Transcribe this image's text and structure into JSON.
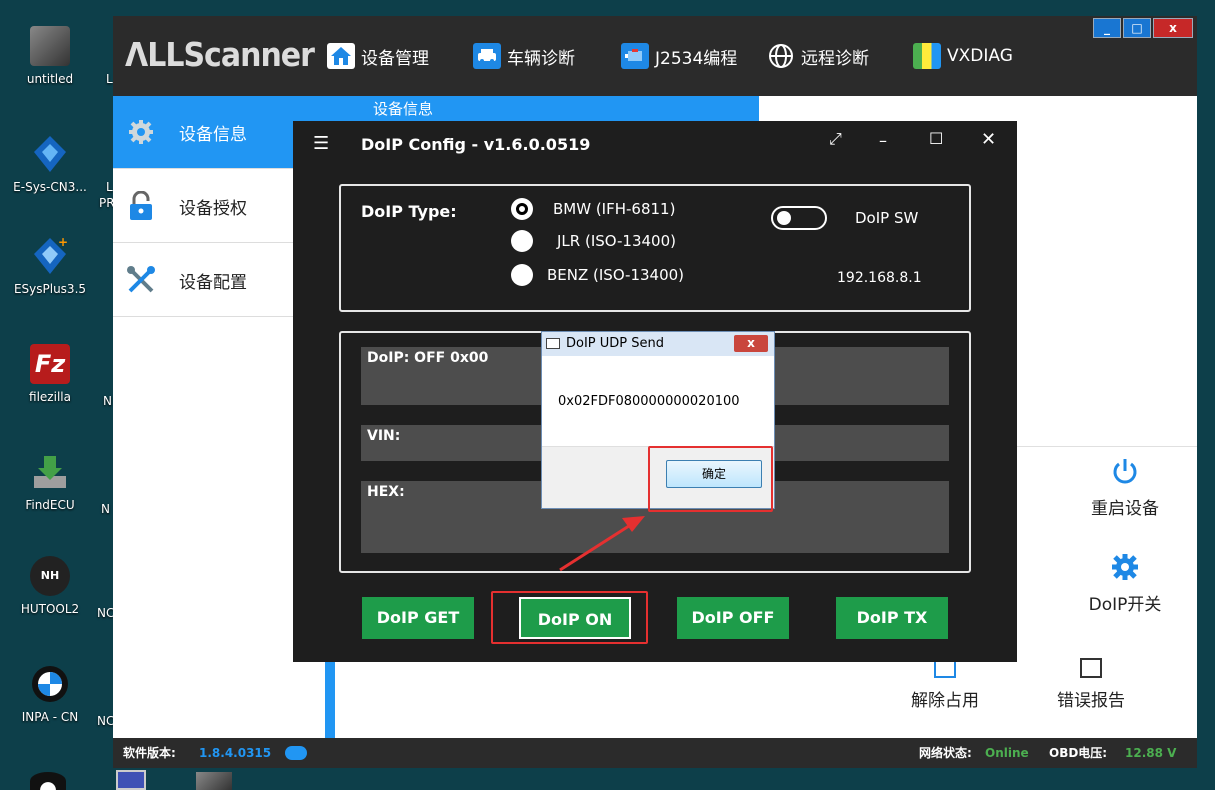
{
  "desktop": {
    "icons": [
      {
        "name": "untitled",
        "label": "untitled"
      },
      {
        "name": "esys",
        "label": "E-Sys-CN3..."
      },
      {
        "name": "esysplus",
        "label": "ESysPlus3.5"
      },
      {
        "name": "filezilla",
        "label": "filezilla"
      },
      {
        "name": "findecu",
        "label": "FindECU"
      },
      {
        "name": "hutool",
        "label": "HUTOOL2"
      },
      {
        "name": "inpa",
        "label": "INPA - CN"
      }
    ],
    "clipped_labels": [
      "L",
      "L",
      "PR",
      "N",
      "N",
      "NC",
      "NC"
    ],
    "clipped_left_labels": [
      ".",
      ".."
    ]
  },
  "app": {
    "logo": "ΛLLScanner",
    "nav": [
      {
        "label": "设备管理",
        "icon": "home-icon"
      },
      {
        "label": "车辆诊断",
        "icon": "car-icon"
      },
      {
        "label": "J2534编程",
        "icon": "engine-icon"
      },
      {
        "label": "远程诊断",
        "icon": "globe-icon"
      },
      {
        "label": "VXDIAG",
        "icon": "vxdiag-icon"
      }
    ],
    "window_buttons": {
      "minimize": "_",
      "maximize": "□",
      "close": "x"
    },
    "sidebar": [
      {
        "label": "设备信息",
        "icon": "gear-icon",
        "active": true
      },
      {
        "label": "设备授权",
        "icon": "lock-icon",
        "active": false
      },
      {
        "label": "设备配置",
        "icon": "tools-icon",
        "active": false
      }
    ],
    "content_header": "设备信息",
    "actions": {
      "restart": "重启设备",
      "doip_switch": "DoIP开关",
      "release": "解除占用",
      "error_report": "错误报告"
    },
    "status": {
      "version_label": "软件版本:",
      "version": "1.8.4.0315",
      "network_label": "网络状态:",
      "network": "Online",
      "obd_label": "OBD电压:",
      "obd": "12.88 V"
    }
  },
  "doip_config": {
    "title": "DoIP Config - v1.6.0.0519",
    "type_label": "DoIP Type:",
    "options": [
      {
        "label": "BMW (IFH-6811)",
        "selected": true
      },
      {
        "label": "JLR (ISO-13400)",
        "selected": false
      },
      {
        "label": "BENZ (ISO-13400)",
        "selected": false
      }
    ],
    "switch_label": "DoIP SW",
    "ip": "192.168.8.1",
    "status_text": "DoIP: OFF 0x00",
    "vin_label": "VIN:",
    "hex_label": "HEX:",
    "buttons": [
      "DoIP GET",
      "DoIP ON",
      "DoIP OFF",
      "DoIP TX"
    ]
  },
  "udp_dialog": {
    "title": "DoIP UDP Send",
    "message": "0x02FDF080000000020100",
    "ok": "确定",
    "close": "x"
  }
}
